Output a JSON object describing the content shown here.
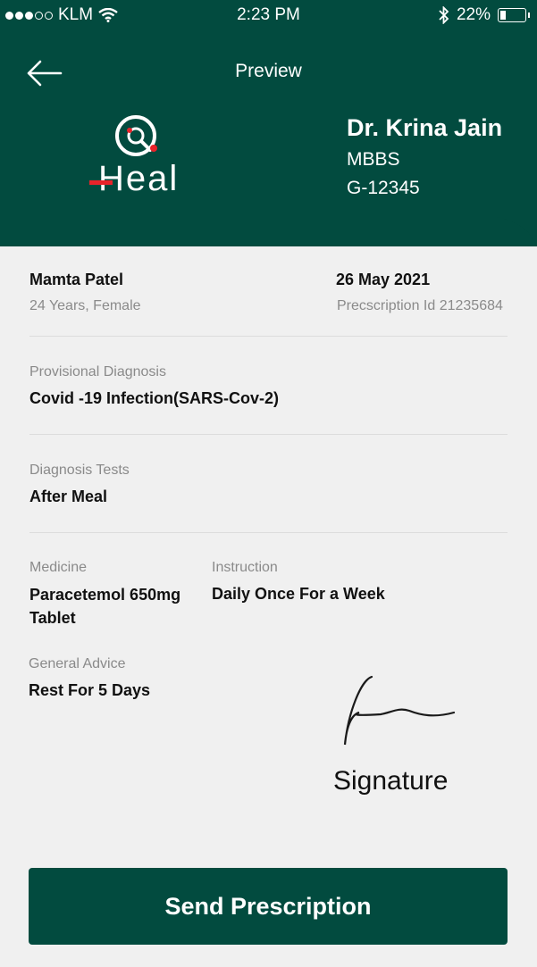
{
  "status_bar": {
    "carrier": "KLM",
    "time": "2:23 PM",
    "battery": "22%",
    "battery_level": 0.22
  },
  "header": {
    "title": "Preview"
  },
  "brand": {
    "logo_text": "Heal"
  },
  "doctor": {
    "name": "Dr. Krina Jain",
    "degree": "MBBS",
    "reg_id": "G-12345"
  },
  "patient": {
    "name": "Mamta Patel",
    "details": "24 Years, Female",
    "date": "26 May 2021",
    "prescription_id": "Precscription Id 21235684"
  },
  "diagnosis": {
    "label": "Provisional Diagnosis",
    "value": "Covid -19 Infection(SARS-Cov-2)"
  },
  "tests": {
    "label": "Diagnosis Tests",
    "value": "After Meal"
  },
  "medicine": {
    "label": "Medicine",
    "name_line1": "Paracetemol 650mg",
    "name_line2": "Tablet",
    "instruction_label": "Instruction",
    "instruction": "Daily Once For a Week"
  },
  "advice": {
    "label": "General Advice",
    "value": "Rest For 5 Days"
  },
  "signature": {
    "label": "Signature"
  },
  "action": {
    "send_label": "Send Prescription"
  },
  "colors": {
    "primary": "#024b3f",
    "background": "#f0f0f0",
    "logo_accent": "#e8232a"
  }
}
